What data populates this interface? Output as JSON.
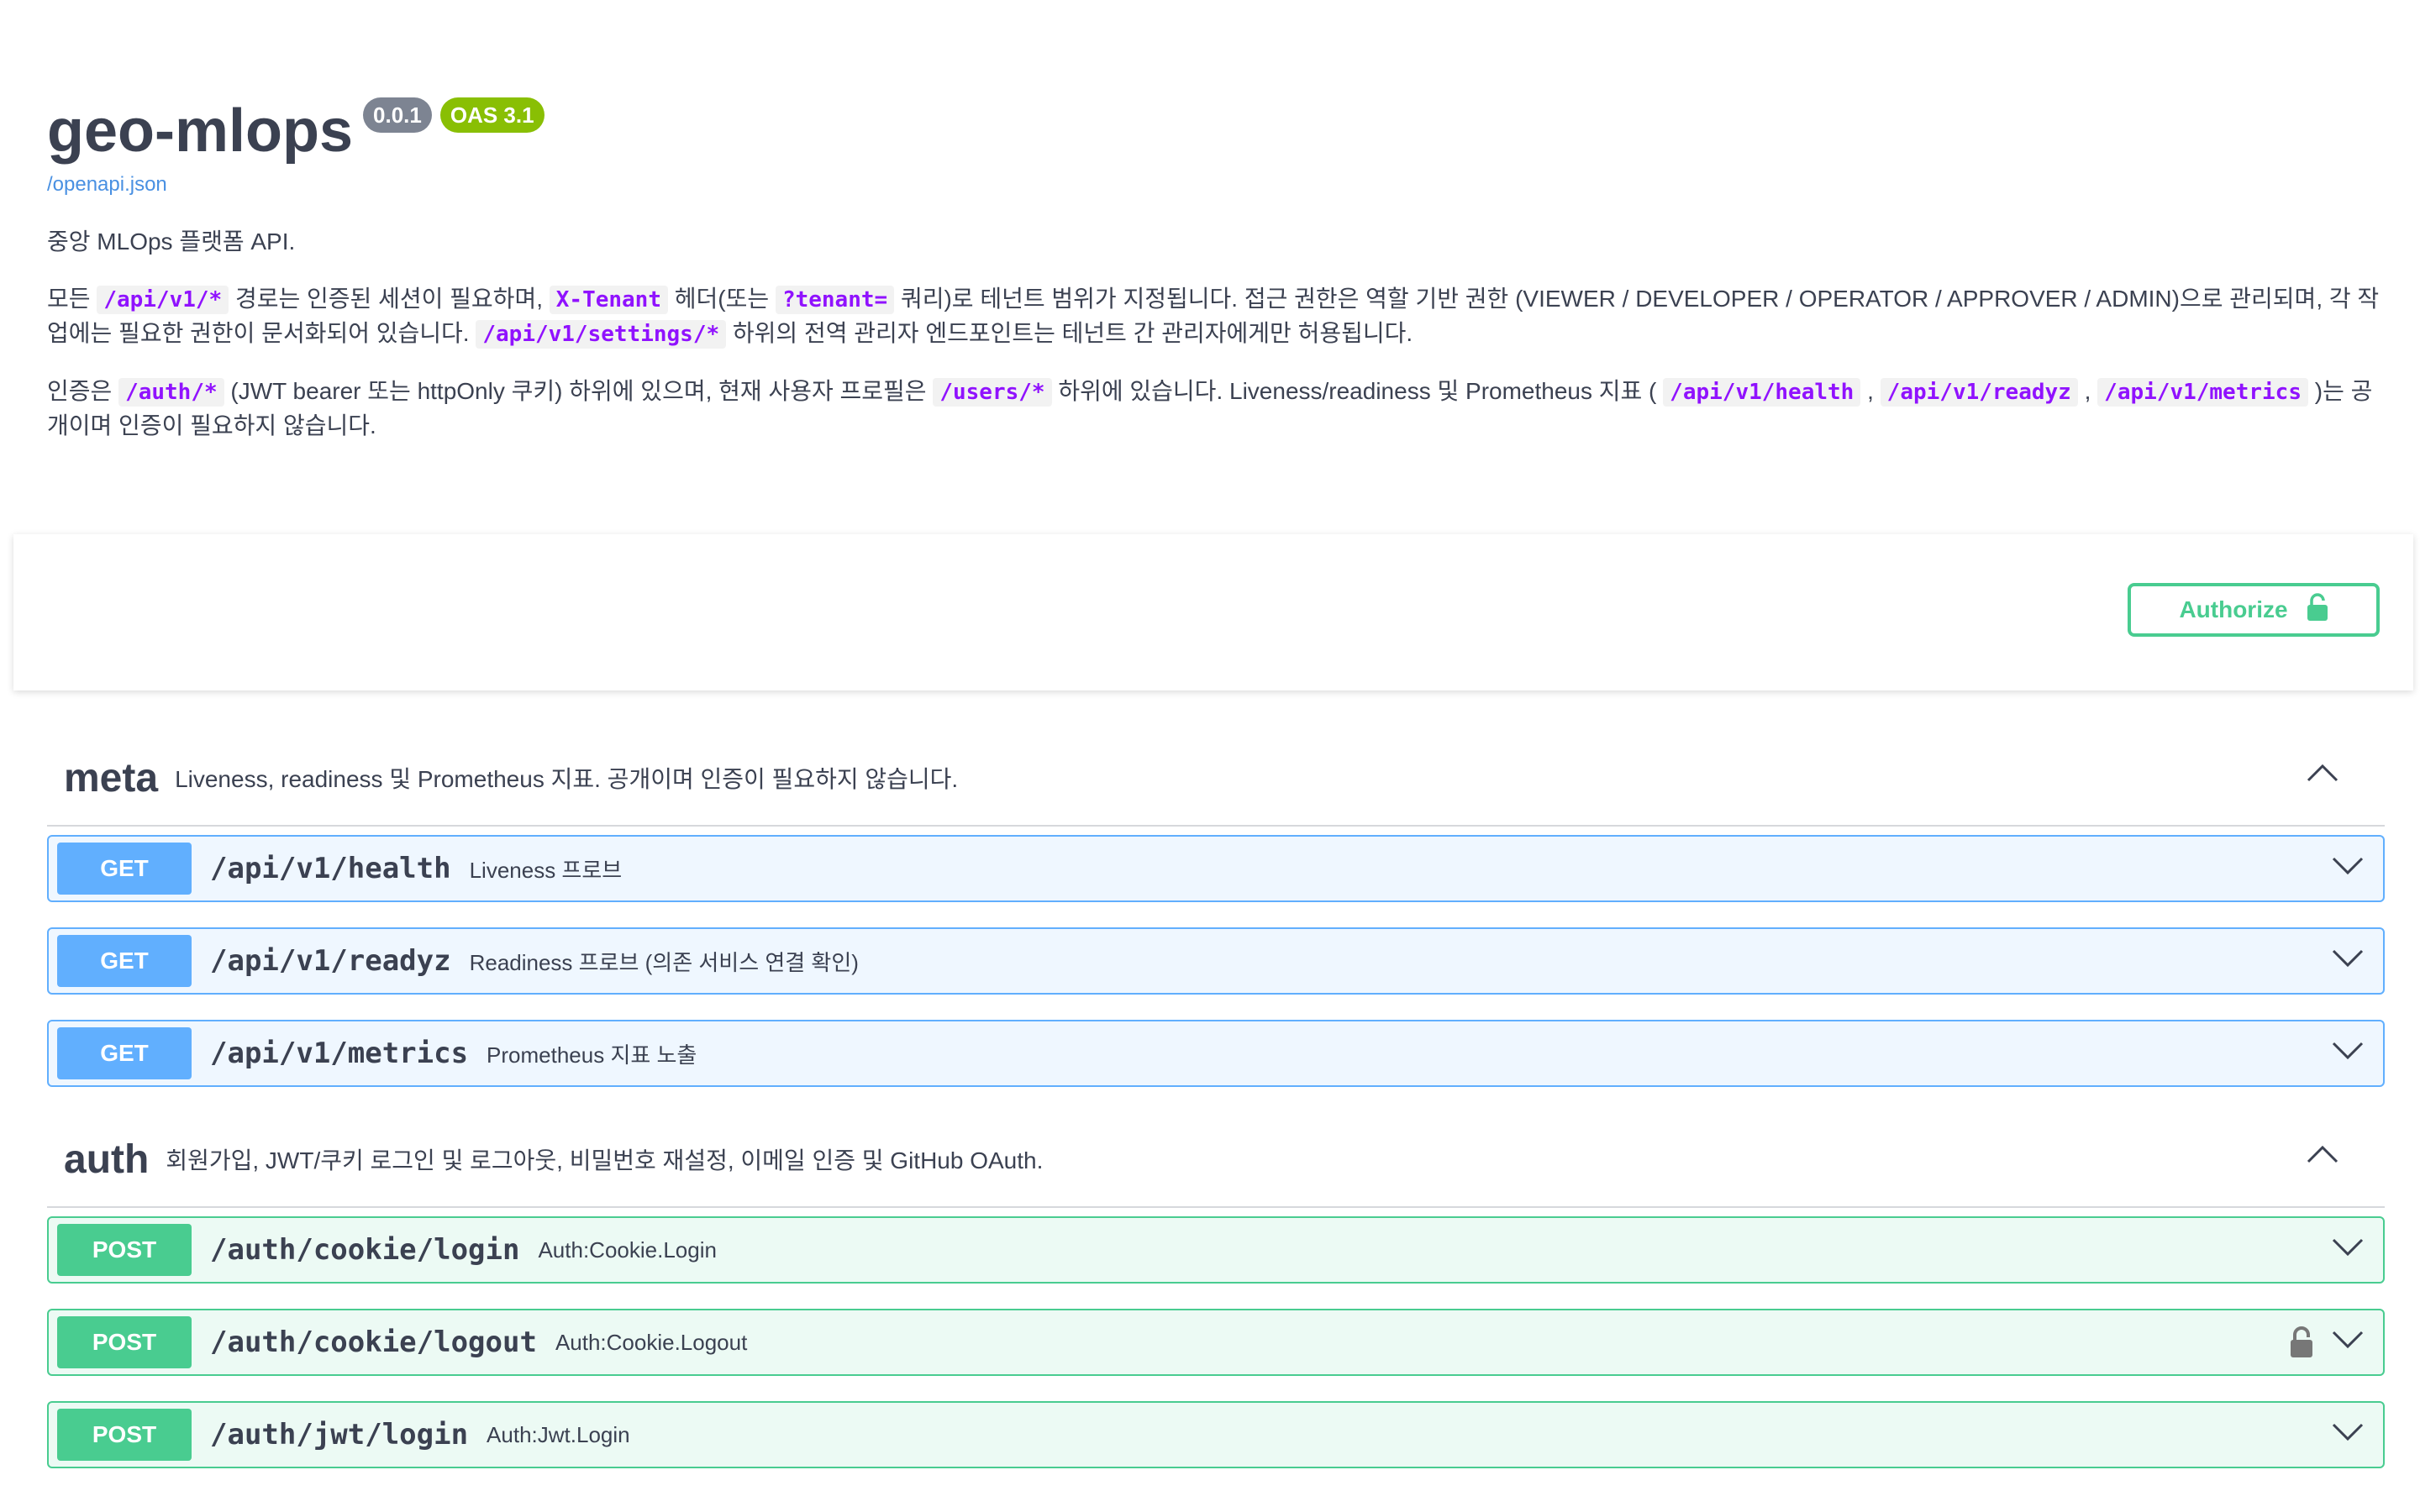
{
  "info": {
    "title": "geo-mlops",
    "version_badge": "0.0.1",
    "oas_badge": "OAS 3.1",
    "spec_link": "/openapi.json",
    "description": {
      "p1": "중앙 MLOps 플랫폼 API.",
      "p2": [
        {
          "t": "text",
          "v": "모든 "
        },
        {
          "t": "code",
          "v": "/api/v1/*"
        },
        {
          "t": "text",
          "v": " 경로는 인증된 세션이 필요하며, "
        },
        {
          "t": "code",
          "v": "X-Tenant"
        },
        {
          "t": "text",
          "v": " 헤더(또는 "
        },
        {
          "t": "code",
          "v": "?tenant="
        },
        {
          "t": "text",
          "v": " 쿼리)로 테넌트 범위가 지정됩니다. 접근 권한은 역할 기반 권한 (VIEWER / DEVELOPER / OPERATOR / APPROVER / ADMIN)으로 관리되며, 각 작업에는 필요한 권한이 문서화되어 있습니다. "
        },
        {
          "t": "code",
          "v": "/api/v1/settings/*"
        },
        {
          "t": "text",
          "v": " 하위의 전역 관리자 엔드포인트는 테넌트 간 관리자에게만 허용됩니다."
        }
      ],
      "p3": [
        {
          "t": "text",
          "v": "인증은 "
        },
        {
          "t": "code",
          "v": "/auth/*"
        },
        {
          "t": "text",
          "v": " (JWT bearer 또는 httpOnly 쿠키) 하위에 있으며, 현재 사용자 프로필은 "
        },
        {
          "t": "code",
          "v": "/users/*"
        },
        {
          "t": "text",
          "v": " 하위에 있습니다. Liveness/readiness 및 Prometheus 지표 ( "
        },
        {
          "t": "code",
          "v": "/api/v1/health"
        },
        {
          "t": "text",
          "v": " , "
        },
        {
          "t": "code",
          "v": "/api/v1/readyz"
        },
        {
          "t": "text",
          "v": " , "
        },
        {
          "t": "code",
          "v": "/api/v1/metrics"
        },
        {
          "t": "text",
          "v": " )는 공개이며 인증이 필요하지 않습니다."
        }
      ]
    }
  },
  "authorize": {
    "label": "Authorize",
    "icon": "unlock-icon"
  },
  "colors": {
    "get": "#61affe",
    "post": "#49cc90",
    "code": "#9012fe"
  },
  "tags": [
    {
      "name": "meta",
      "description": "Liveness, readiness 및 Prometheus 지표. 공개이며 인증이 필요하지 않습니다.",
      "ops": [
        {
          "method": "GET",
          "path": "/api/v1/health",
          "summary": "Liveness 프로브",
          "locked": false
        },
        {
          "method": "GET",
          "path": "/api/v1/readyz",
          "summary": "Readiness 프로브 (의존 서비스 연결 확인)",
          "locked": false
        },
        {
          "method": "GET",
          "path": "/api/v1/metrics",
          "summary": "Prometheus 지표 노출",
          "locked": false
        }
      ]
    },
    {
      "name": "auth",
      "description": "회원가입, JWT/쿠키 로그인 및 로그아웃, 비밀번호 재설정, 이메일 인증 및 GitHub OAuth.",
      "ops": [
        {
          "method": "POST",
          "path": "/auth/cookie/login",
          "summary": "Auth:Cookie.Login",
          "locked": false
        },
        {
          "method": "POST",
          "path": "/auth/cookie/logout",
          "summary": "Auth:Cookie.Logout",
          "locked": true
        },
        {
          "method": "POST",
          "path": "/auth/jwt/login",
          "summary": "Auth:Jwt.Login",
          "locked": false
        }
      ]
    }
  ]
}
